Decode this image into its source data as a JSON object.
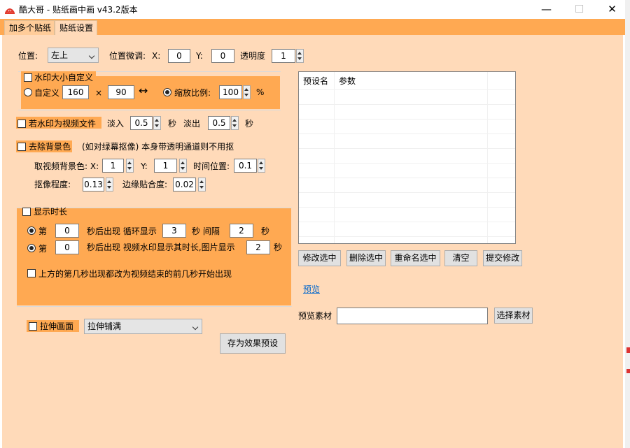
{
  "window": {
    "title": "酷大哥 -  贴纸画中画   v43.2版本",
    "minimize_glyph": "—",
    "maximize_glyph": "☐",
    "close_glyph": "✕",
    "icon": "app-logo-icon"
  },
  "tabs": [
    {
      "label": "加多个贴纸"
    },
    {
      "label": "贴纸设置"
    }
  ],
  "position": {
    "label": "位置:",
    "value": "左上",
    "fine_tune_label": "位置微调:",
    "x_label": "X:",
    "x_value": "0",
    "y_label": "Y:",
    "y_value": "0",
    "opacity_label": "透明度",
    "opacity_value": "1"
  },
  "watermark_size": {
    "checkbox_label": "水印大小自定义",
    "custom_label": "自定义",
    "width": "160",
    "times": "×",
    "height": "90",
    "link_glyph": "↔",
    "scale_label": "缩放比例:",
    "scale_value": "100",
    "percent": "%"
  },
  "video_watermark": {
    "checkbox_label": "若水印为视频文件",
    "fade_in_label": "淡入",
    "fade_in_value": "0.5",
    "sec1": "秒",
    "fade_out_label": "淡出",
    "fade_out_value": "0.5",
    "sec2": "秒"
  },
  "remove_bg": {
    "checkbox_label": "去除背景色",
    "note": "(如对绿幕抠像) 本身带透明通道则不用抠",
    "pick_label": "取视频背景色: X:",
    "pick_x": "1",
    "y_label": "Y:",
    "pick_y": "1",
    "time_label": "时间位置:",
    "time_value": "0.1",
    "degree_label": "抠像程度:",
    "degree_value": "0.13",
    "edge_label": "边缘贴合度:",
    "edge_value": "0.02"
  },
  "duration": {
    "checkbox_label": "显示时长",
    "row1_di": "第",
    "row1_value": "0",
    "row1_text": "秒后出现 循环显示",
    "row1_show": "3",
    "row1_sec": "秒  间隔",
    "row1_interval": "2",
    "row1_sec2": "秒",
    "row2_di": "第",
    "row2_value": "0",
    "row2_text": "秒后出现    视频水印显示其时长,图片显示",
    "row2_show": "2",
    "row2_sec": "秒",
    "end_checkbox_label": "上方的第几秒出现都改为视频结束的前几秒开始出现"
  },
  "stretch": {
    "checkbox_label": "拉伸画面",
    "select_value": "拉伸铺满",
    "save_preset_label": "存为效果预设"
  },
  "preset_table": {
    "columns": [
      "预设名",
      "参数"
    ],
    "rows": []
  },
  "preset_buttons": [
    {
      "label": "修改选中"
    },
    {
      "label": "删除选中"
    },
    {
      "label": "重命名选中"
    },
    {
      "label": "清空"
    },
    {
      "label": "提交修改"
    }
  ],
  "preview": {
    "link_label": "预览",
    "material_label": "预览素材",
    "material_value": "",
    "select_button": "选择素材"
  }
}
